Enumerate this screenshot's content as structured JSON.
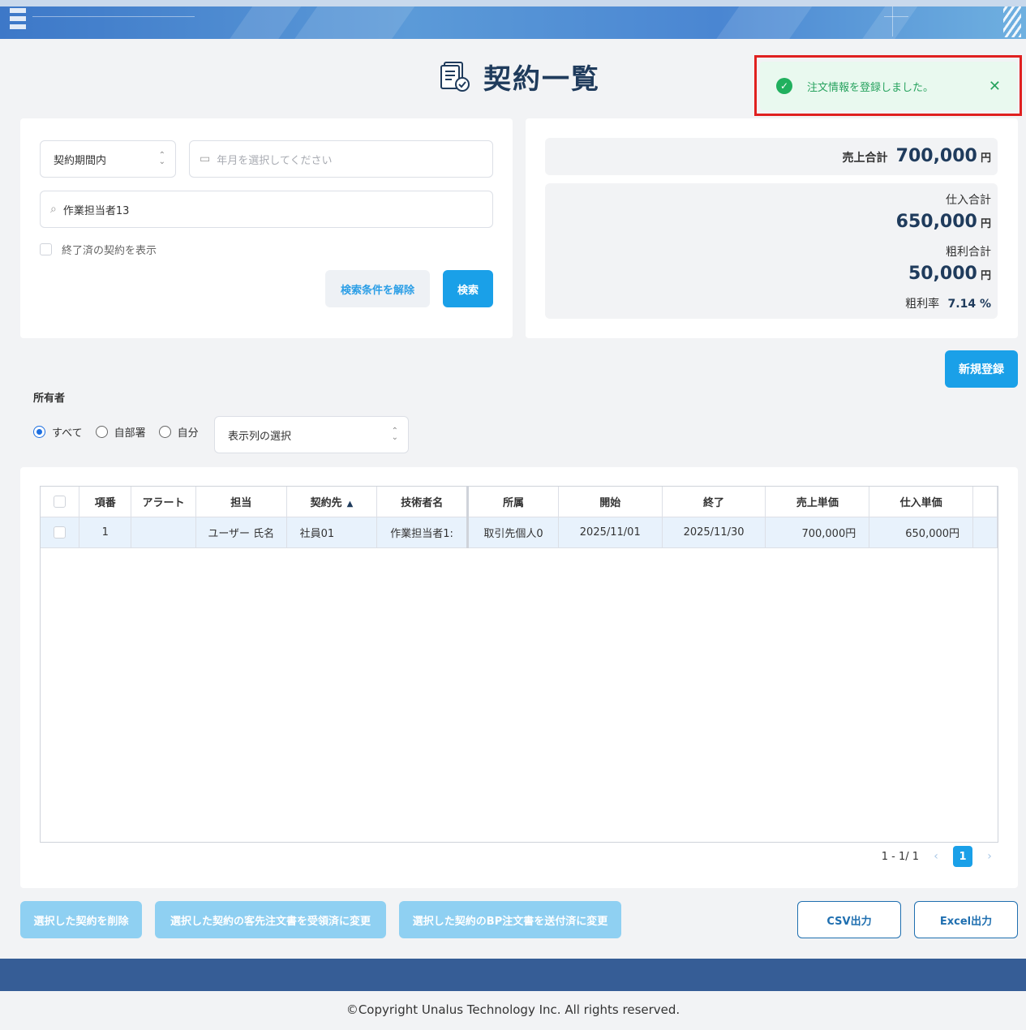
{
  "header": {
    "title": "契約一覧"
  },
  "toast": {
    "message": "注文情報を登録しました。",
    "close": "✕"
  },
  "search": {
    "period_select": "契約期間内",
    "month_placeholder": "年月を選択してください",
    "keyword_value": "作業担当者13",
    "show_finished_label": "終了済の契約を表示",
    "clear_label": "検索条件を解除",
    "search_label": "検索"
  },
  "summary": {
    "sales_label": "売上合計",
    "sales_value": "700,000",
    "yen": "円",
    "purchase_label": "仕入合計",
    "purchase_value": "650,000",
    "gross_label": "粗利合計",
    "gross_value": "50,000",
    "rate_label": "粗利率",
    "rate_value": "7.14 %"
  },
  "new_button": "新規登録",
  "owner": {
    "label": "所有者",
    "options": [
      "すべて",
      "自部署",
      "自分"
    ],
    "selected": "すべて",
    "column_select": "表示列の選択"
  },
  "table": {
    "headers": [
      "項番",
      "アラート",
      "担当",
      "契約先",
      "技術者名",
      "所属",
      "開始",
      "終了",
      "売上単価",
      "仕入単価"
    ],
    "rows": [
      [
        "1",
        "",
        "ユーザー 氏名",
        "社員01",
        "作業担当者1:",
        "取引先個人0",
        "2025/11/01",
        "2025/11/30",
        "700,000円",
        "650,000円"
      ]
    ]
  },
  "pager": {
    "range": "1 - 1/ 1",
    "current": "1"
  },
  "actions": {
    "delete": "選択した契約を削除",
    "client_order": "選択した契約の客先注文書を受領済に変更",
    "bp_order": "選択した契約のBP注文書を送付済に変更",
    "csv": "CSV出力",
    "excel": "Excel出力"
  },
  "footer": {
    "copyright": "©Copyright Unalus Technology Inc. All rights reserved."
  }
}
